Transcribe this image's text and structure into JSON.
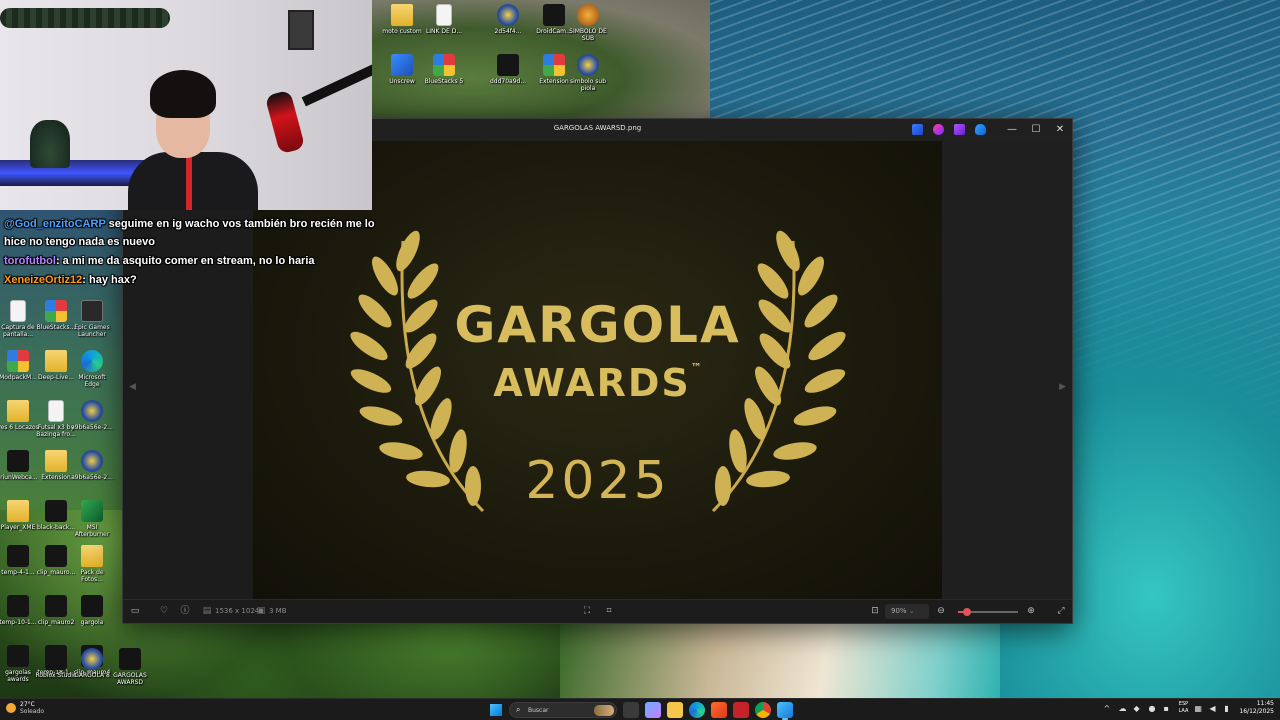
{
  "window": {
    "title": "GARGOLAS AWARSD.png",
    "controls": {
      "minimize": "—",
      "maximize": "☐",
      "close": "✕"
    }
  },
  "image": {
    "title_line1": "GARGOLA",
    "title_line2": "AWARDS",
    "trademark": "™",
    "year": "2025",
    "gold": "#d8bd5e",
    "background": "#1c1a0c"
  },
  "viewer_bar": {
    "dimensions": "1536 x 1024",
    "file_size": "3 MB",
    "zoom": "90%",
    "zoom_level": 0.15
  },
  "chat": [
    {
      "user": "@God_enzitoCARP",
      "prefix": "",
      "text": " seguime en ig wacho vos también bro recién me lo hice no tengo nada es nuevo",
      "color": "blue"
    },
    {
      "user": "torofutbol",
      "prefix": "",
      "text": ": a mi me da asquito comer en stream, no lo haria",
      "color": "purple"
    },
    {
      "user": "XeneizeOrtiz12",
      "prefix": "",
      "text": ": hay hax?",
      "color": "orange"
    }
  ],
  "desktop_icons_top": [
    {
      "label": "moto custom",
      "type": "folder"
    },
    {
      "label": "LINK DE D...",
      "type": "doc"
    },
    {
      "label": "2d54f4...",
      "type": "round"
    },
    {
      "label": "DroidCam...",
      "type": "dark"
    },
    {
      "label": "SIMBOLO DE SUB",
      "type": "monkey"
    },
    {
      "label": "Unscrew",
      "type": "blue"
    },
    {
      "label": "BlueStacks 5",
      "type": "multi"
    },
    {
      "label": "ddd70a9d...",
      "type": "dark"
    },
    {
      "label": "Extension",
      "type": "multi"
    },
    {
      "label": "simbolo sub piola",
      "type": "round"
    }
  ],
  "desktop_icons_left": [
    {
      "label": "Captura de pantalla...",
      "type": "doc"
    },
    {
      "label": "BlueStacks...",
      "type": "multi"
    },
    {
      "label": "Epic Games Launcher",
      "type": "epic"
    },
    {
      "label": "ModpackM...",
      "type": "multi"
    },
    {
      "label": "Deep-Live...",
      "type": "folder"
    },
    {
      "label": "Microsoft Edge",
      "type": "edge"
    },
    {
      "label": "Pes 6 Locazos",
      "type": "folder"
    },
    {
      "label": "Futsal x3 by Bazinga fro...",
      "type": "doc"
    },
    {
      "label": "a9b6a56e-2...",
      "type": "round"
    },
    {
      "label": "IriunWebca...",
      "type": "dark"
    },
    {
      "label": "Extension",
      "type": "folder"
    },
    {
      "label": "a9b6a56e-2...",
      "type": "round"
    },
    {
      "label": "Player_XME",
      "type": "folder"
    },
    {
      "label": "black-back...",
      "type": "dark"
    },
    {
      "label": "MSI Afterburner",
      "type": "green"
    },
    {
      "label": "temp-4-1...",
      "type": "dark"
    },
    {
      "label": "clip_mauro...",
      "type": "dark"
    },
    {
      "label": "Pack de Fotos...",
      "type": "folder"
    },
    {
      "label": "temp-10-1...",
      "type": "dark"
    },
    {
      "label": "clip_mauro2",
      "type": "dark"
    },
    {
      "label": "gargola",
      "type": "dark"
    },
    {
      "label": "gargolas awards",
      "type": "dark"
    },
    {
      "label": "temp-18-1...",
      "type": "dark"
    },
    {
      "label": "clip_mauro4",
      "type": "dark"
    },
    {
      "label": "Roblox Studio",
      "type": "dark"
    },
    {
      "label": "GARGOLA 8",
      "type": "round"
    },
    {
      "label": "GARGOLAS AWARSD",
      "type": "dark"
    }
  ],
  "taskbar": {
    "temperature": "27°C",
    "condition": "Soleado",
    "search_placeholder": "Buscar",
    "lang_line1": "ESP",
    "lang_line2": "LAA",
    "time": "11:45",
    "date": "16/12/2025"
  }
}
